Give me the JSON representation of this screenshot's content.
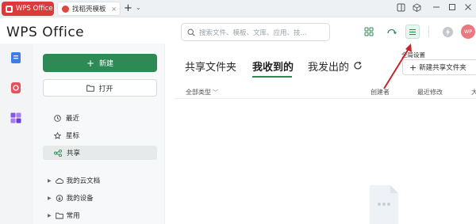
{
  "titlebar": {
    "tabs": [
      {
        "label": "WPS Office",
        "color": "#d93b3a"
      },
      {
        "label": "找稻壳模板",
        "close": "×"
      }
    ],
    "new_tab": "+",
    "tab_menu": "⌄"
  },
  "header": {
    "brand": "WPS Office",
    "search_placeholder": "搜索文件、模板、文库、应用、技...",
    "menu_tooltip": "全局设置",
    "avatar": "WP",
    "accent": "#2e8a55"
  },
  "sidebar": {
    "new_label": "新建",
    "open_label": "打开",
    "nav": [
      {
        "label": "最近",
        "icon": "clock-icon"
      },
      {
        "label": "星标",
        "icon": "star-icon"
      },
      {
        "label": "共享",
        "icon": "share-icon",
        "active": true
      }
    ],
    "tree": [
      {
        "label": "我的云文档",
        "icon": "cloud-icon"
      },
      {
        "label": "我的设备",
        "icon": "device-icon"
      },
      {
        "label": "常用",
        "icon": "folder-icon"
      }
    ]
  },
  "main": {
    "tabs": [
      "共享文件夹",
      "我收到的",
      "我发出的"
    ],
    "active_tab": "我收到的",
    "new_share_folder": "新建共享文件夹",
    "columns": {
      "type_filter": "全部类型",
      "creator": "创建者",
      "modified": "最近修改",
      "size": "大"
    }
  }
}
